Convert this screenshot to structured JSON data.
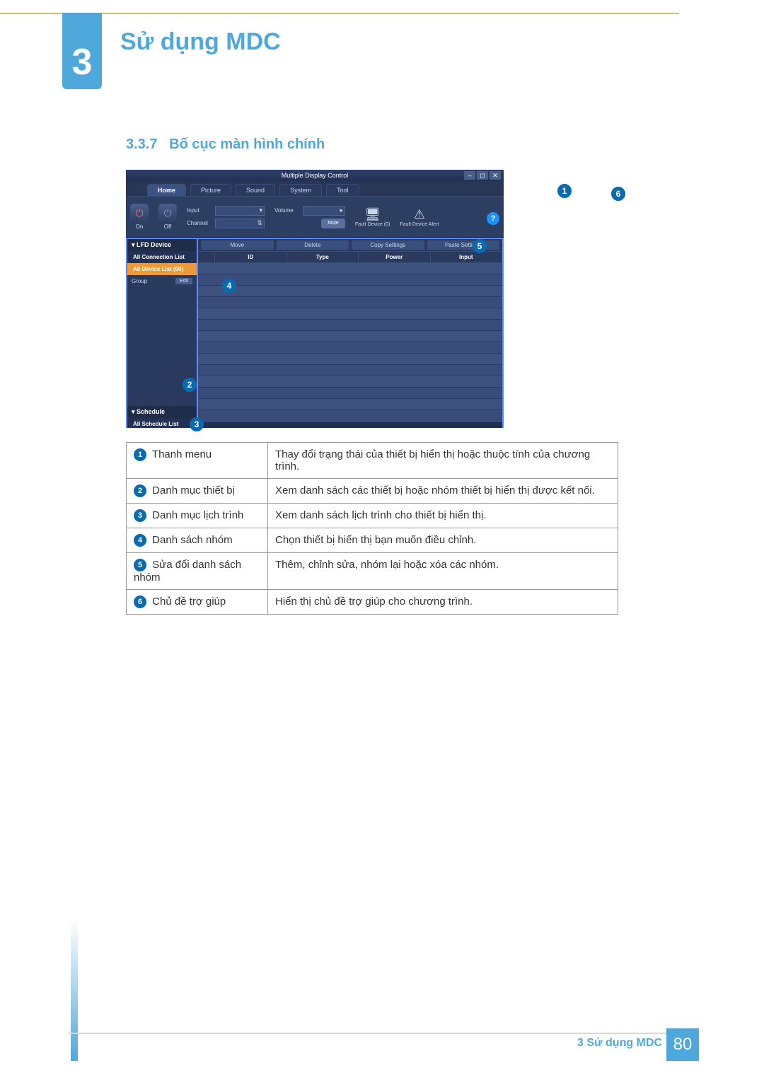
{
  "chapter": {
    "number": "3",
    "title": "Sử dụng MDC"
  },
  "section": {
    "number": "3.3.7",
    "title": "Bố cục màn hình chính"
  },
  "app": {
    "window_title": "Multiple Display Control",
    "tabs": [
      "Home",
      "Picture",
      "Sound",
      "System",
      "Tool"
    ],
    "power_on": "On",
    "power_off": "Off",
    "input_label": "Input",
    "channel_label": "Channel",
    "volume_label": "Volume",
    "mute": "Mute",
    "fault1": "Fault Device (0)",
    "fault2": "Fault Device Alert",
    "sidebar": {
      "lfd_head": "LFD Device",
      "all_conn": "All Connection List",
      "all_dev": "All Device List (00)",
      "group": "Group",
      "edit": "Edit",
      "sched_head": "Schedule",
      "sched_item": "All Schedule List"
    },
    "toolbar": [
      "Move",
      "Delete",
      "Copy Settings",
      "Paste Settings"
    ],
    "grid_headers": [
      "",
      "ID",
      "Type",
      "Power",
      "Input"
    ]
  },
  "callouts": {
    "c1": "1",
    "c2": "2",
    "c3": "3",
    "c4": "4",
    "c5": "5",
    "c6": "6"
  },
  "desc": [
    {
      "n": "1",
      "name": "Thanh menu",
      "text": "Thay đổi trạng thái của thiết bị hiển thị hoặc thuộc tính của chương trình."
    },
    {
      "n": "2",
      "name": "Danh mục thiết bị",
      "text": "Xem danh sách các thiết bị hoặc nhóm thiết bị hiển thị được kết nối."
    },
    {
      "n": "3",
      "name": "Danh mục lịch trình",
      "text": "Xem danh sách lịch trình cho thiết bị hiển thị."
    },
    {
      "n": "4",
      "name": "Danh sách nhóm",
      "text": "Chọn thiết bị hiển thị bạn muốn điều chỉnh."
    },
    {
      "n": "5",
      "name": "Sửa đổi danh sách nhóm",
      "text": "Thêm, chỉnh sửa, nhóm lại hoặc xóa các nhóm."
    },
    {
      "n": "6",
      "name": "Chủ đề trợ giúp",
      "text": "Hiển thị chủ đề trợ giúp cho chương trình."
    }
  ],
  "footer": {
    "chapter_label": "3 Sử dụng MDC",
    "page": "80"
  }
}
